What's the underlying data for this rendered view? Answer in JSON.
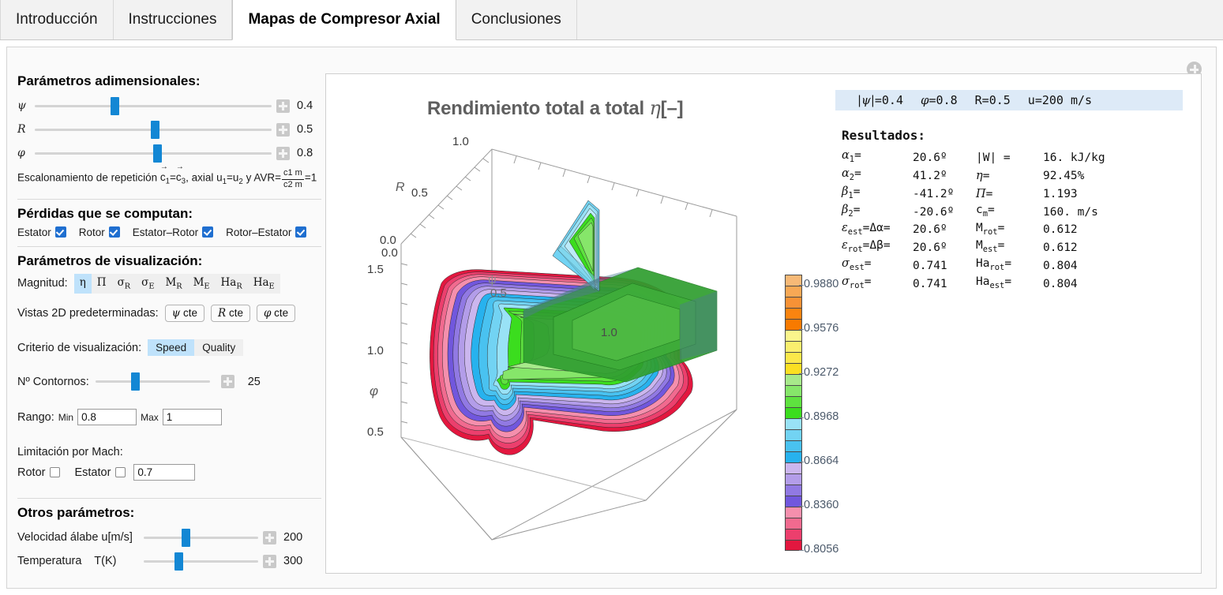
{
  "tabs": [
    {
      "label": "Introducción",
      "active": false
    },
    {
      "label": "Instrucciones",
      "active": false
    },
    {
      "label": "Mapas de Compresor Axial",
      "active": true
    },
    {
      "label": "Conclusiones",
      "active": false
    }
  ],
  "left_panel": {
    "dimensionless": {
      "title": "Parámetros adimensionales:",
      "sliders": [
        {
          "label": "ψ",
          "value": "0.4",
          "pct": 32
        },
        {
          "label": "R",
          "value": "0.5",
          "pct": 49
        },
        {
          "label": "φ",
          "value": "0.8",
          "pct": 50
        }
      ],
      "note_pre": "Escalonamiento de repetición ",
      "note_c1": "c",
      "note_c1sub": "1",
      "note_eq": "=",
      "note_c3": "c",
      "note_c3sub": "3",
      "note_mid": ", axial u",
      "note_u1sub": "1",
      "note_ueq": "=u",
      "note_u2sub": "2",
      "note_avr": " y AVR=",
      "frac_num": "c1 m",
      "frac_den": "c2 m",
      "note_end": "=1"
    },
    "losses": {
      "title": "Pérdidas que se computan:",
      "items": [
        {
          "label": "Estator",
          "checked": true
        },
        {
          "label": "Rotor",
          "checked": true
        },
        {
          "label": "Estator–Rotor",
          "checked": true
        },
        {
          "label": "Rotor–Estator",
          "checked": true
        }
      ]
    },
    "visualization": {
      "title": "Parámetros de visualización:",
      "magnitude_label": "Magnitud:",
      "magnitudes": [
        {
          "base": "η",
          "sub": "",
          "selected": true
        },
        {
          "base": "Π",
          "sub": "",
          "selected": false
        },
        {
          "base": "σ",
          "sub": "R",
          "selected": false
        },
        {
          "base": "σ",
          "sub": "E",
          "selected": false
        },
        {
          "base": "M",
          "sub": "R",
          "selected": false
        },
        {
          "base": "M",
          "sub": "E",
          "selected": false
        },
        {
          "base": "Ha",
          "sub": "R",
          "selected": false
        },
        {
          "base": "Ha",
          "sub": "E",
          "selected": false
        }
      ],
      "views_label": "Vistas 2D predeterminadas:",
      "views": [
        {
          "sym": "ψ",
          "text": " cte"
        },
        {
          "sym": "R",
          "text": " cte"
        },
        {
          "sym": "φ",
          "text": " cte"
        }
      ],
      "criterion_label": "Criterio de visualización:",
      "criteria": [
        {
          "label": "Speed",
          "selected": true
        },
        {
          "label": "Quality",
          "selected": false
        }
      ],
      "contours_label": "Nº Contornos:",
      "contours_value": "25",
      "contours_pct": 31,
      "range_label": "Rango:",
      "range_min_label": "Min",
      "range_min_value": "0.8",
      "range_max_label": "Max",
      "range_max_value": "1",
      "mach_label": "Limitación por Mach:",
      "mach_rotor_label": "Rotor",
      "mach_rotor_checked": false,
      "mach_stator_label": "Estator",
      "mach_stator_checked": false,
      "mach_value": "0.7"
    },
    "others": {
      "title": "Otros parámetros:",
      "sliders": [
        {
          "label": "Velocidad álabe u[m/s]",
          "value": "200",
          "pct": 33
        },
        {
          "label": "Temperatura    T(K)",
          "value": "300",
          "pct": 27
        }
      ]
    }
  },
  "plot": {
    "title_text": "Rendimiento total a total ",
    "title_sym": "η",
    "title_unit": "[–]",
    "axes": {
      "r_label": "R",
      "r_ticks": [
        "1.0",
        "0.5",
        "0.0"
      ],
      "psi_label": "ψ",
      "psi_ticks": [
        "0.0",
        "0.5",
        "1.0"
      ],
      "phi_label": "φ",
      "phi_ticks": [
        "1.5",
        "1.0",
        "0.5"
      ]
    }
  },
  "colorbar": {
    "ticks": [
      "0.9880",
      "0.9576",
      "0.9272",
      "0.8968",
      "0.8664",
      "0.8360",
      "0.8056"
    ],
    "colors": [
      "#f7b977",
      "#f7a855",
      "#f79236",
      "#fa8410",
      "#f87a00",
      "#fbf58c",
      "#faef6e",
      "#fbe84a",
      "#fbdf22",
      "#a7e98a",
      "#86e66a",
      "#5ee23f",
      "#3bdd1e",
      "#99e2f6",
      "#72d3f3",
      "#49c2f0",
      "#27b2ee",
      "#cbb6ee",
      "#b39de9",
      "#9179e3",
      "#7157dd",
      "#f58fad",
      "#f16a8f",
      "#ec3f6d",
      "#e3173f"
    ]
  },
  "results": {
    "header": {
      "psi_label": "|ψ|",
      "psi": "=0.4",
      "phi_label": "φ",
      "phi": "=0.8",
      "r_label": "R",
      "r": "=0.5",
      "u_label": "u",
      "u": "=200 m/s"
    },
    "title": "Resultados:",
    "rows": [
      {
        "l1": "α1=",
        "v1": " 20.6º",
        "l2": "|W| =",
        "v2": "   16. kJ/kg"
      },
      {
        "l1": "α2=",
        "v1": " 41.2º",
        "l2": "η=",
        "v2": "  92.45%"
      },
      {
        "l1": "β1=",
        "v1": "-41.2º",
        "l2": "Π=",
        "v2": "  1.193"
      },
      {
        "l1": "β2=",
        "v1": "-20.6º",
        "l2": "cm=",
        "v2": "  160. m/s"
      },
      {
        "l1": "εest=Δα=",
        "v1": " 20.6º",
        "l2": "Mrot=",
        "v2": " 0.612"
      },
      {
        "l1": "εrot=Δβ=",
        "v1": " 20.6º",
        "l2": "Mest=",
        "v2": " 0.612"
      },
      {
        "l1": "σest=",
        "v1": " 0.741",
        "l2": "Harot=",
        "v2": " 0.804"
      },
      {
        "l1": "σrot=",
        "v1": " 0.741",
        "l2": "Haest=",
        "v2": " 0.804"
      }
    ],
    "rows_rich": [
      {
        "s1": "α",
        "b1": "1",
        "t1": "= ",
        "v1": "20.6º",
        "s2": "|W| =",
        "b2": "",
        "t2": "",
        "v2": "16. kJ/kg"
      },
      {
        "s1": "α",
        "b1": "2",
        "t1": "= ",
        "v1": "41.2º",
        "s2": "η",
        "b2": "",
        "t2": "= ",
        "v2": "92.45%"
      },
      {
        "s1": "β",
        "b1": "1",
        "t1": "=",
        "v1": "-41.2º",
        "s2": "Π",
        "b2": "",
        "t2": "= ",
        "v2": "1.193"
      },
      {
        "s1": "β",
        "b1": "2",
        "t1": "=",
        "v1": "-20.6º",
        "s2": "c",
        "b2": "m",
        "t2": "= ",
        "v2": "160. m/s"
      },
      {
        "s1": "ε",
        "b1": "est",
        "t1": "=Δα= ",
        "v1": "20.6º",
        "s2": "M",
        "b2": "rot",
        "t2": "= ",
        "v2": "0.612"
      },
      {
        "s1": "ε",
        "b1": "rot",
        "t1": "=Δβ= ",
        "v1": "20.6º",
        "s2": "M",
        "b2": "est",
        "t2": "= ",
        "v2": "0.612"
      },
      {
        "s1": "σ",
        "b1": "est",
        "t1": "= ",
        "v1": "0.741",
        "s2": "Ha",
        "b2": "rot",
        "t2": "= ",
        "v2": "0.804"
      },
      {
        "s1": "σ",
        "b1": "rot",
        "t1": "= ",
        "v1": "0.741",
        "s2": "Ha",
        "b2": "est",
        "t2": "= ",
        "v2": "0.804"
      }
    ]
  },
  "chart_data": {
    "type": "contour",
    "title": "Rendimiento total a total η[–]",
    "xlabel": "ψ",
    "ylabel": "R",
    "zlabel": "φ",
    "xlim": [
      0.0,
      1.0
    ],
    "ylim": [
      0.0,
      1.0
    ],
    "zlim": [
      0.5,
      1.5
    ],
    "contour_count": 25,
    "value_range": [
      0.8,
      1.0
    ],
    "colorbar_ticks": [
      0.8056,
      0.836,
      0.8664,
      0.8968,
      0.9272,
      0.9576,
      0.988
    ],
    "legend": "none",
    "grid": false
  }
}
